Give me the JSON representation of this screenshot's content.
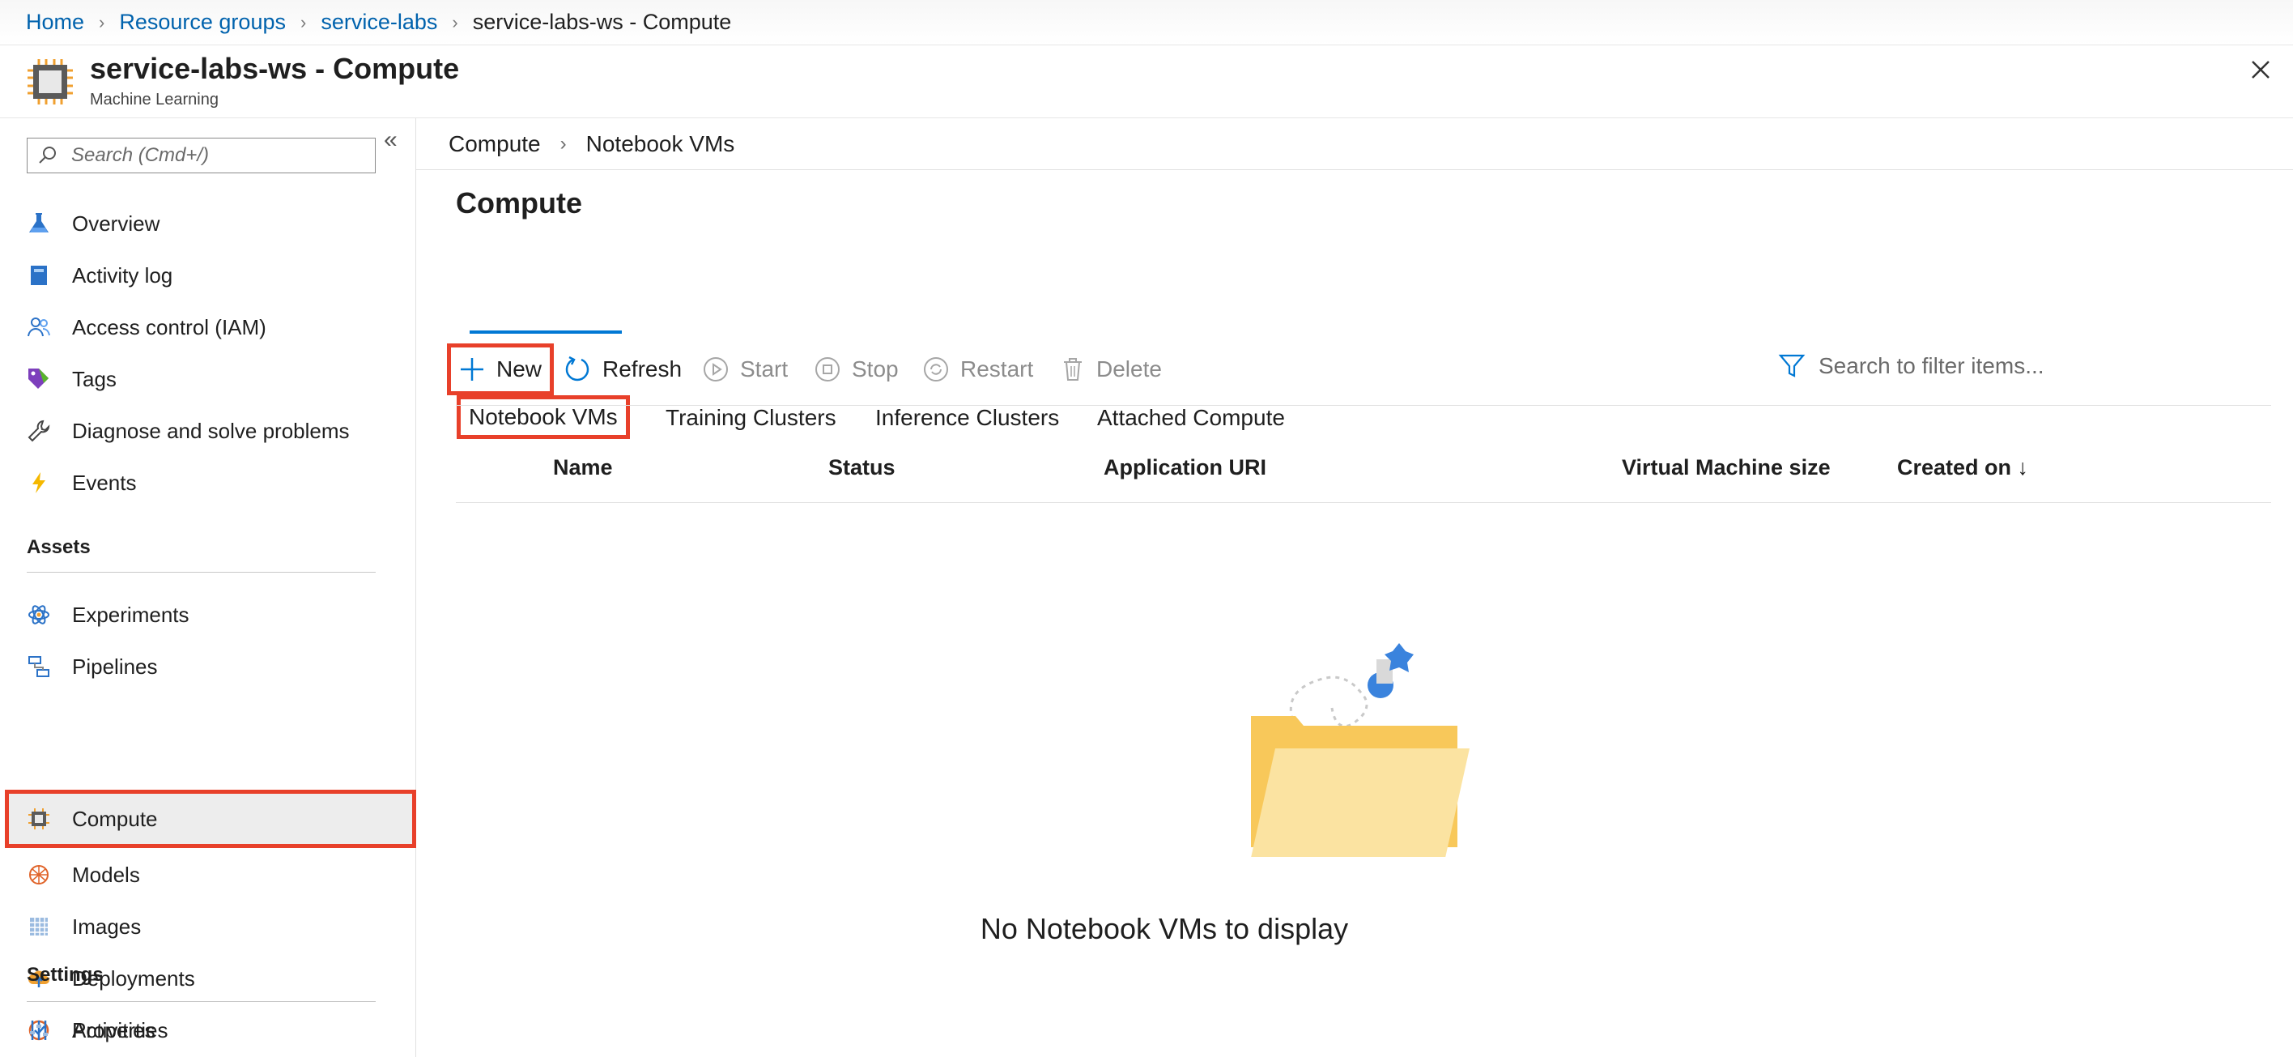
{
  "breadcrumb": {
    "items": [
      "Home",
      "Resource groups",
      "service-labs"
    ],
    "current": "service-labs-ws - Compute"
  },
  "header": {
    "title": "service-labs-ws - Compute",
    "subtitle": "Machine Learning",
    "icon": "cpu-chip-icon"
  },
  "sidebar": {
    "search_placeholder": "Search (Cmd+/)",
    "items": [
      {
        "label": "Overview",
        "icon": "flask-icon"
      },
      {
        "label": "Activity log",
        "icon": "log-book-icon"
      },
      {
        "label": "Access control (IAM)",
        "icon": "people-icon"
      },
      {
        "label": "Tags",
        "icon": "tag-icon"
      },
      {
        "label": "Diagnose and solve problems",
        "icon": "wrench-icon"
      },
      {
        "label": "Events",
        "icon": "lightning-icon"
      }
    ],
    "assets_label": "Assets",
    "assets": [
      {
        "label": "Experiments",
        "icon": "atom-icon"
      },
      {
        "label": "Pipelines",
        "icon": "pipeline-icon"
      },
      {
        "label": "Compute",
        "icon": "cpu-chip-icon",
        "active": true
      },
      {
        "label": "Models",
        "icon": "model-cube-icon"
      },
      {
        "label": "Images",
        "icon": "image-grid-icon"
      },
      {
        "label": "Deployments",
        "icon": "cloud-upload-icon"
      },
      {
        "label": "Activities",
        "icon": "activity-check-icon"
      }
    ],
    "settings_label": "Settings",
    "settings": [
      {
        "label": "Properties",
        "icon": "sliders-icon"
      }
    ]
  },
  "main": {
    "subcrumb": [
      "Compute",
      "Notebook VMs"
    ],
    "title": "Compute",
    "tabs": [
      "Notebook VMs",
      "Training Clusters",
      "Inference Clusters",
      "Attached Compute"
    ],
    "active_tab": "Notebook VMs",
    "toolbar": {
      "new": "New",
      "refresh": "Refresh",
      "start": "Start",
      "stop": "Stop",
      "restart": "Restart",
      "delete": "Delete",
      "filter_placeholder": "Search to filter items..."
    },
    "columns": [
      "Name",
      "Status",
      "Application URI",
      "Virtual Machine size",
      "Created on ↓"
    ],
    "empty_message": "No Notebook VMs to display"
  },
  "colors": {
    "link": "#0062ad",
    "accent": "#0078d4",
    "highlight": "#e8402a",
    "folder": "#f8c85a"
  }
}
